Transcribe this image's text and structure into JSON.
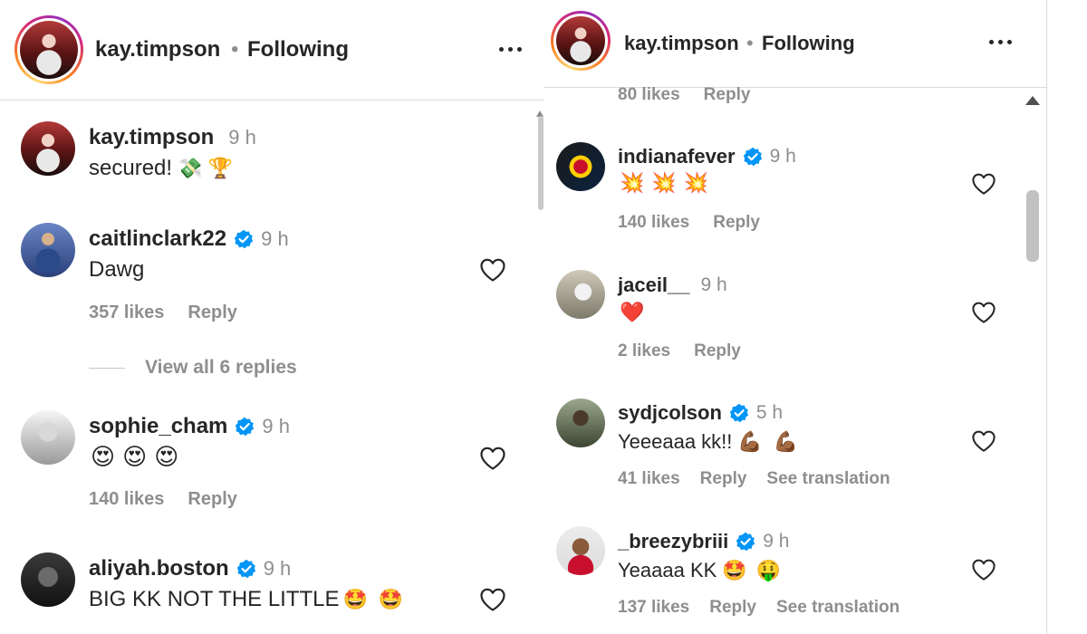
{
  "left": {
    "header": {
      "username": "kay.timpson",
      "separator": "•",
      "status": "Following"
    },
    "comments": [
      {
        "username": "kay.timpson",
        "verified": false,
        "time": "9 h",
        "text": "secured!",
        "emojis": [
          "💸",
          "🏆"
        ],
        "avatar": "profile-photo"
      },
      {
        "username": "caitlinclark22",
        "verified": true,
        "time": "9 h",
        "text": "Dawg",
        "emojis": [],
        "likes": "357 likes",
        "reply": "Reply",
        "avatar": "profile-photo"
      },
      {
        "username": "sophie_cham",
        "verified": true,
        "time": "9 h",
        "text": "",
        "emojis": [
          "😍",
          "😍",
          "😍"
        ],
        "likes": "140 likes",
        "reply": "Reply",
        "avatar": "profile-photo"
      },
      {
        "username": "aliyah.boston",
        "verified": true,
        "time": "9 h",
        "text": "BIG KK NOT THE LITTLE",
        "emojis": [
          "🤩",
          "🤩"
        ],
        "avatar": "profile-photo"
      }
    ],
    "view_replies": "View all 6 replies"
  },
  "right": {
    "header": {
      "username": "kay.timpson",
      "separator": "•",
      "status": "Following"
    },
    "top_partial": {
      "likes": "80 likes",
      "reply": "Reply"
    },
    "comments": [
      {
        "username": "indianafever",
        "verified": true,
        "time": "9 h",
        "text": "",
        "emojis": [
          "💥",
          "💥",
          "💥"
        ],
        "likes": "140 likes",
        "reply": "Reply",
        "avatar": "team-logo"
      },
      {
        "username": "jaceil__",
        "verified": false,
        "time": "9 h",
        "text": "",
        "emojis": [
          "❤️"
        ],
        "likes": "2 likes",
        "reply": "Reply",
        "avatar": "profile-photo"
      },
      {
        "username": "sydjcolson",
        "verified": true,
        "time": "5 h",
        "text": "Yeeeaaa kk!!",
        "emojis": [
          "💪🏾",
          "💪🏾"
        ],
        "likes": "41 likes",
        "reply": "Reply",
        "translation": "See translation",
        "avatar": "profile-photo"
      },
      {
        "username": "_breezybriii",
        "verified": true,
        "time": "9 h",
        "text": "Yeaaaa KK",
        "emojis": [
          "🤩",
          "🤑"
        ],
        "likes": "137 likes",
        "reply": "Reply",
        "translation": "See translation",
        "avatar": "profile-photo"
      }
    ]
  },
  "colors": {
    "text": "#262626",
    "secondary": "#8e8e8e",
    "verified": "#0095f6",
    "border": "#dbdbdb"
  },
  "icons": [
    "more-options-icon",
    "verified-badge-icon",
    "heart-icon",
    "scroll-up-arrow-icon"
  ]
}
